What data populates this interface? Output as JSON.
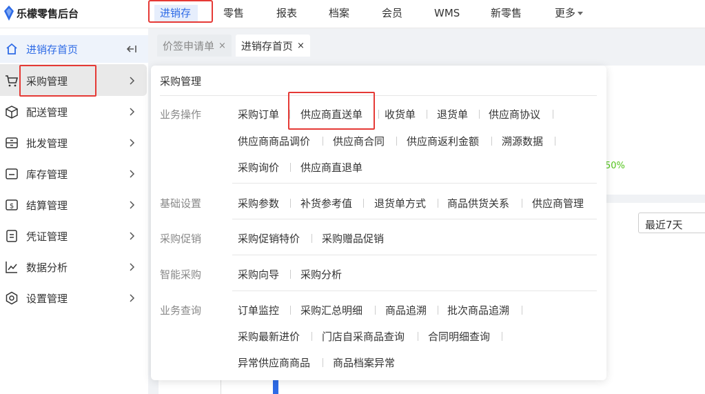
{
  "app": {
    "logo_text": "乐檬零售后台"
  },
  "topnav": {
    "items": [
      "进销存",
      "零售",
      "报表",
      "档案",
      "会员",
      "WMS",
      "新零售",
      "更多"
    ]
  },
  "sidebar": {
    "home_label": "进销存首页",
    "items": [
      "采购管理",
      "配送管理",
      "批发管理",
      "库存管理",
      "结算管理",
      "凭证管理",
      "数据分析",
      "设置管理"
    ]
  },
  "tabs": [
    {
      "label": "价签申请单",
      "close": "×"
    },
    {
      "label": "进销存首页",
      "close": "×"
    }
  ],
  "background": {
    "green_text": "50%",
    "date_range": "最近7天"
  },
  "flyout": {
    "title": "采购管理",
    "sections": [
      {
        "label": "业务操作",
        "rows": [
          [
            "采购订单",
            "供应商直送单",
            "收货单",
            "退货单",
            "供应商协议"
          ],
          [
            "供应商商品调价",
            "供应商合同",
            "供应商返利金额",
            "溯源数据"
          ],
          [
            "采购询价",
            "供应商直退单"
          ]
        ]
      },
      {
        "label": "基础设置",
        "rows": [
          [
            "采购参数",
            "补货参考值",
            "退货单方式",
            "商品供货关系",
            "供应商管理"
          ]
        ]
      },
      {
        "label": "采购促销",
        "rows": [
          [
            "采购促销特价",
            "采购赠品促销"
          ]
        ]
      },
      {
        "label": "智能采购",
        "rows": [
          [
            "采购向导",
            "采购分析"
          ]
        ]
      },
      {
        "label": "业务查询",
        "rows": [
          [
            "订单监控",
            "采购汇总明细",
            "商品追溯",
            "批次商品追溯"
          ],
          [
            "采购最新进价",
            "门店自采商品查询",
            "合同明细查询"
          ],
          [
            "异常供应商商品",
            "商品档案异常"
          ]
        ]
      }
    ]
  },
  "colors": {
    "accent": "#2e6be6",
    "highlight": "#e53935"
  }
}
